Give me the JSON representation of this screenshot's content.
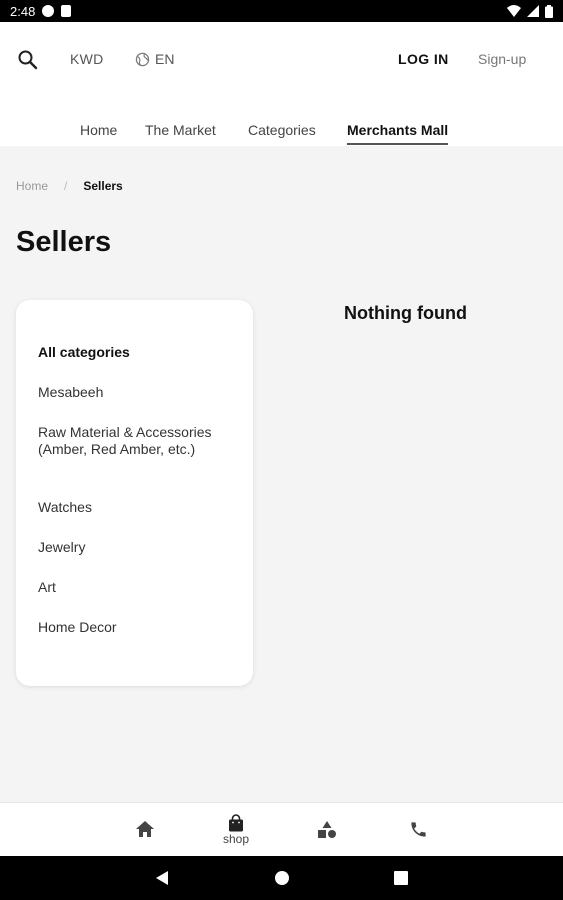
{
  "status_bar": {
    "time": "2:48"
  },
  "header": {
    "currency": "KWD",
    "language": "EN",
    "login_label": "LOG IN",
    "signup_label": "Sign-up"
  },
  "nav": {
    "tabs": [
      {
        "label": "Home"
      },
      {
        "label": "The Market"
      },
      {
        "label": "Categories"
      },
      {
        "label": "Merchants Mall",
        "active": true
      }
    ]
  },
  "breadcrumb": {
    "home": "Home",
    "separator": "/",
    "current": "Sellers"
  },
  "page": {
    "title": "Sellers",
    "empty_message": "Nothing found"
  },
  "categories": [
    {
      "label": "All categories",
      "active": true
    },
    {
      "label": "Mesabeeh"
    },
    {
      "label": "Raw Material & Accessories (Amber, Red Amber, etc.)"
    },
    {
      "label": "Watches"
    },
    {
      "label": "Jewelry"
    },
    {
      "label": "Art"
    },
    {
      "label": "Home Decor"
    }
  ],
  "bottom_nav": {
    "items": [
      {
        "icon": "home-icon",
        "label": ""
      },
      {
        "icon": "shopping-bag-icon",
        "label": "shop"
      },
      {
        "icon": "shapes-icon",
        "label": ""
      },
      {
        "icon": "phone-icon",
        "label": ""
      }
    ]
  },
  "colors": {
    "background": "#f4f4f4",
    "card": "#ffffff",
    "text": "#111111",
    "muted": "#999999"
  }
}
